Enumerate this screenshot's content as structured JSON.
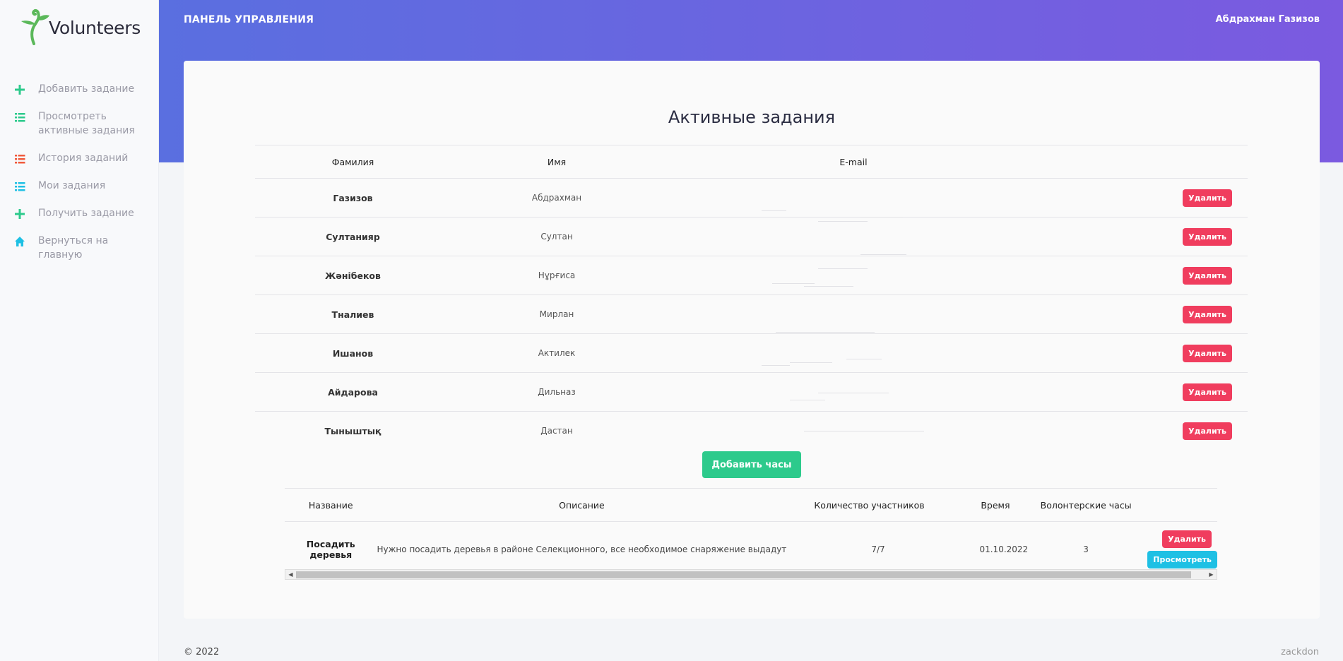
{
  "brand": {
    "name": "Volunteers",
    "accent": "#5bb85a"
  },
  "sidebar": {
    "items": [
      {
        "label": "Добавить задание",
        "icon": "plus-icon",
        "color": "#2dca8c"
      },
      {
        "label": "Просмотреть активные задания",
        "icon": "list-icon",
        "color": "#2dca8c"
      },
      {
        "label": "История заданий",
        "icon": "list-icon",
        "color": "#f05a3c"
      },
      {
        "label": "Мои задания",
        "icon": "list-icon",
        "color": "#1ec0e4"
      },
      {
        "label": "Получить задание",
        "icon": "plus-icon",
        "color": "#2dca8c"
      },
      {
        "label": "Вернуться на главную",
        "icon": "home-icon",
        "color": "#1ec0e4"
      }
    ]
  },
  "header": {
    "title": "ПАНЕЛЬ УПРАВЛЕНИЯ",
    "user": "Абдрахман Газизов"
  },
  "main": {
    "title": "Активные задания",
    "participants": {
      "columns": [
        "Фамилия",
        "Имя",
        "E-mail",
        ""
      ],
      "delete_label": "Удалить",
      "rows": [
        {
          "surname": "Газизов",
          "name": "Абдрахман"
        },
        {
          "surname": "Султанияр",
          "name": "Султан"
        },
        {
          "surname": "Жәнібеков",
          "name": "Нұрғиса"
        },
        {
          "surname": "Тналиев",
          "name": "Мирлан"
        },
        {
          "surname": "Ишанов",
          "name": "Актилек"
        },
        {
          "surname": "Айдарова",
          "name": "Дильназ"
        },
        {
          "surname": "Тыныштық",
          "name": "Дастан"
        }
      ]
    },
    "add_hours_label": "Добавить часы",
    "tasks": {
      "columns": [
        "Название",
        "Описание",
        "Количество участников",
        "Время",
        "Волонтерские часы",
        ""
      ],
      "rows": [
        {
          "title": "Посадить деревья",
          "description": "Нужно посадить деревья в районе Селекционного, все необходимое снаряжение выдадут",
          "participants": "7/7",
          "date": "01.10.2022",
          "hours": "3",
          "delete_label": "Удалить",
          "view_label": "Просмотреть"
        }
      ]
    }
  },
  "footer": {
    "copyright": "© 2022",
    "author": "zackdon"
  }
}
